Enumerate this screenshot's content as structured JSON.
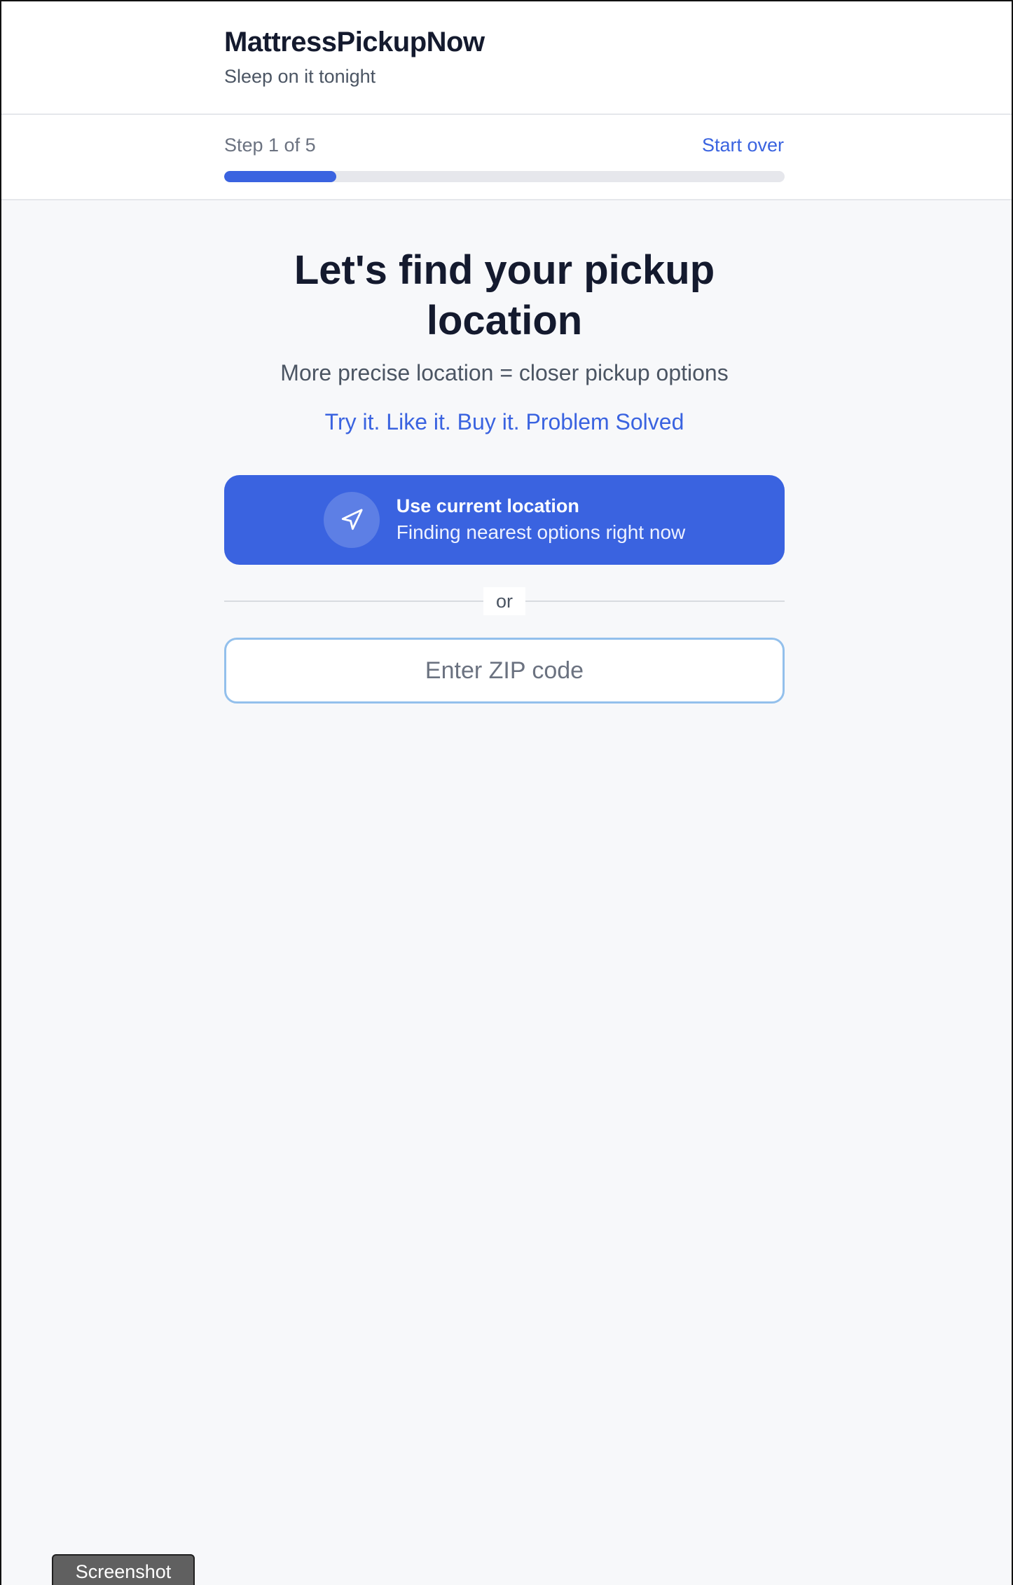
{
  "header": {
    "brand": "MattressPickupNow",
    "tagline": "Sleep on it tonight"
  },
  "progress": {
    "step_label": "Step 1 of 5",
    "start_over": "Start over",
    "current_step": 1,
    "total_steps": 5,
    "fraction": 0.2
  },
  "main": {
    "heading": "Let's find your pickup location",
    "subheading": "More precise location = closer pickup options",
    "slogan": "Try it. Like it. Buy it. Problem Solved",
    "location_button": {
      "title": "Use current location",
      "subtitle": "Finding nearest options right now",
      "icon": "navigation-arrow-icon"
    },
    "divider_text": "or",
    "zip": {
      "placeholder": "Enter ZIP code",
      "value": ""
    }
  },
  "footer": {
    "screenshot_label": "Screenshot"
  },
  "colors": {
    "accent": "#3a63e0",
    "background": "#f7f8fa",
    "heading": "#141a2e"
  }
}
